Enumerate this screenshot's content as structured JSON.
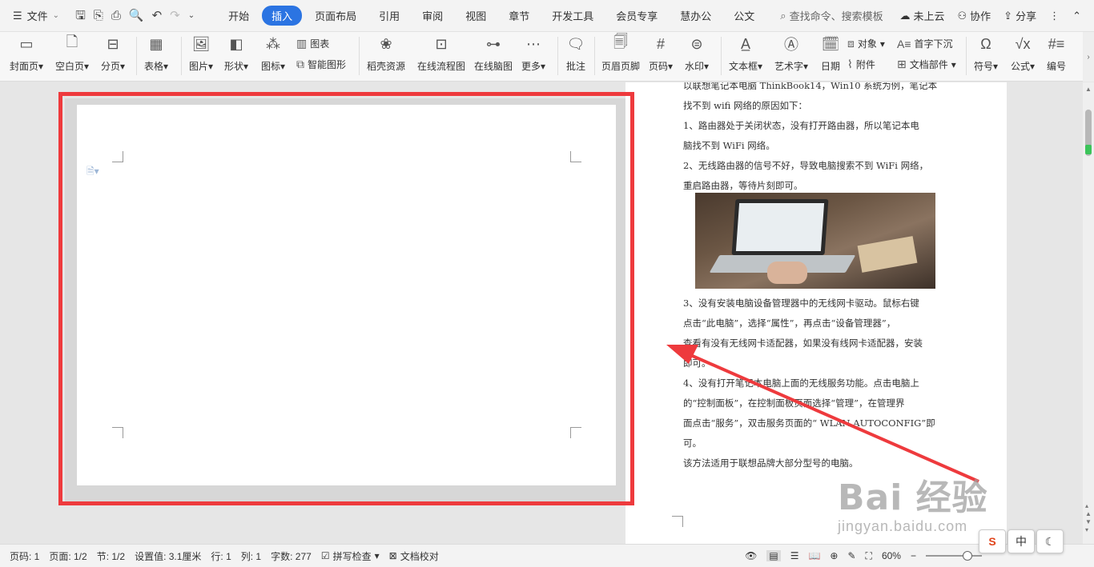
{
  "menubar": {
    "file_label": "文件",
    "tabs": [
      {
        "label": "开始"
      },
      {
        "label": "插入"
      },
      {
        "label": "页面布局"
      },
      {
        "label": "引用"
      },
      {
        "label": "审阅"
      },
      {
        "label": "视图"
      },
      {
        "label": "章节"
      },
      {
        "label": "开发工具"
      },
      {
        "label": "会员专享"
      },
      {
        "label": "慧办公"
      },
      {
        "label": "公文"
      }
    ],
    "active_tab": "插入",
    "search_placeholder": "查找命令、搜索模板",
    "cloud_label": "未上云",
    "collab_label": "协作",
    "share_label": "分享"
  },
  "ribbon": {
    "cover_page": "封面页",
    "blank_page": "空白页",
    "page_break": "分页",
    "table": "表格",
    "picture": "图片",
    "shape": "形状",
    "icon": "图标",
    "chart": "图表",
    "smart_art": "智能图形",
    "docer_resources": "稻壳资源",
    "online_flowchart": "在线流程图",
    "online_mindmap": "在线脑图",
    "more": "更多",
    "comment": "批注",
    "header_footer": "页眉页脚",
    "page_number": "页码",
    "watermark": "水印",
    "text_box": "文本框",
    "word_art": "艺术字",
    "date": "日期",
    "object": "对象",
    "attachment": "附件",
    "drop_cap": "首字下沉",
    "doc_parts": "文档部件",
    "symbol": "符号",
    "formula": "公式",
    "numbering": "编号"
  },
  "document": {
    "paragraphs": [
      "以联想笔记本电脑 ThinkBook14，Win10 系统为例，笔记本",
      "找不到 wifi 网络的原因如下：",
      "1、路由器处于关闭状态，没有打开路由器，所以笔记本电",
      "脑找不到 WiFi 网络。",
      "2、无线路由器的信号不好，导致电脑搜索不到 WiFi 网络，",
      "重启路由器，等待片刻即可。"
    ],
    "paragraphs_after": [
      "3、没有安装电脑设备管理器中的无线网卡驱动。鼠标右键",
      "点击“此电脑”，选择“属性”，再点击“设备管理器”，",
      "查看有没有无线网卡适配器，如果没有线网卡适配器，安装",
      "即可。",
      "4、没有打开笔记本电脑上面的无线服务功能。点击电脑上",
      "的“控制面板”，在控制面板页面选择“管理”，在管理界",
      "面点击“服务”，双击服务页面的“ WLAN AUTOCONFIG”即",
      "可。",
      "该方法适用于联想品牌大部分型号的电脑。"
    ]
  },
  "watermark": {
    "brand": "Bai 经验",
    "url": "jingyan.baidu.com"
  },
  "statusbar": {
    "page_num": "页码: 1",
    "page_count": "页面: 1/2",
    "section": "节: 1/2",
    "position": "设置值: 3.1厘米",
    "line": "行: 1",
    "column": "列: 1",
    "word_count": "字数: 277",
    "spell_check": "拼写检查",
    "doc_proof": "文档校对",
    "zoom": "60%"
  },
  "ime": {
    "chinese": "中"
  },
  "colors": {
    "accent": "#2b74e2",
    "highlight": "#ee3a3d",
    "arrow": "#ee3a3d"
  }
}
